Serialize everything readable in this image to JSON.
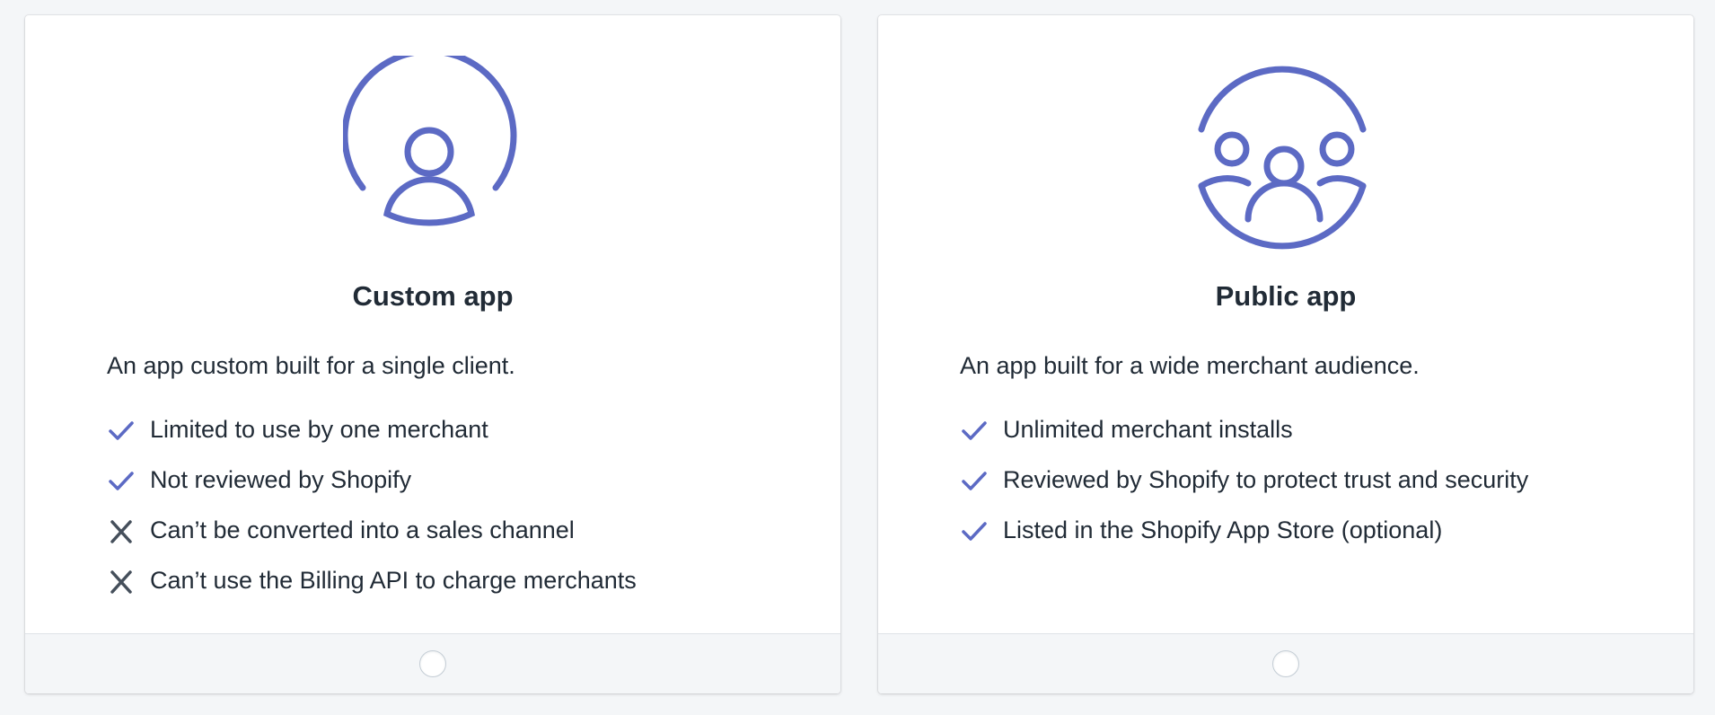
{
  "colors": {
    "accent": "#5c6ac4",
    "cross": "#454f5b",
    "text": "#212b36",
    "background": "#f4f6f8"
  },
  "cards": [
    {
      "icon": "single-user-circle-icon",
      "title": "Custom app",
      "description": "An app custom built for a single client.",
      "features": [
        {
          "kind": "check",
          "icon": "checkmark-icon",
          "text": "Limited to use by one merchant"
        },
        {
          "kind": "check",
          "icon": "checkmark-icon",
          "text": "Not reviewed by Shopify"
        },
        {
          "kind": "cross",
          "icon": "cross-icon",
          "text": "Can’t be converted into a sales channel"
        },
        {
          "kind": "cross",
          "icon": "cross-icon",
          "text": "Can’t use the Billing API to charge merchants"
        }
      ],
      "selected": false
    },
    {
      "icon": "multiple-users-circle-icon",
      "title": "Public app",
      "description": "An app built for a wide merchant audience.",
      "features": [
        {
          "kind": "check",
          "icon": "checkmark-icon",
          "text": "Unlimited merchant installs"
        },
        {
          "kind": "check",
          "icon": "checkmark-icon",
          "text": "Reviewed by Shopify to protect trust and security"
        },
        {
          "kind": "check",
          "icon": "checkmark-icon",
          "text": "Listed in the Shopify App Store (optional)"
        }
      ],
      "selected": false
    }
  ]
}
